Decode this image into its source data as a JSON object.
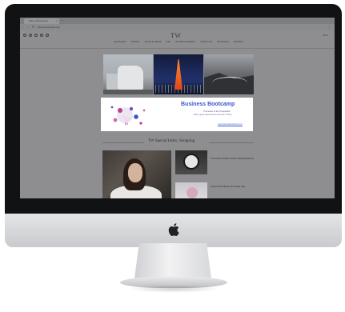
{
  "browser": {
    "tab_title": "Tokyo Weekender",
    "tab_close": "×",
    "new_tab": "+",
    "url": "tokyoweekender.com",
    "menu": "⋮",
    "nav_back": "‹",
    "nav_forward": "›",
    "nav_reload": "↻"
  },
  "site": {
    "logo": "TW",
    "header_right": "EN ▾",
    "nav": [
      "FEATURES",
      "TRAVEL",
      "FOOD & DRINK",
      "ART",
      "ENTERTAINMENT",
      "LIFESTYLE",
      "BUSINESS",
      "PEOPLE"
    ]
  },
  "photos": {
    "labels": [
      "",
      "",
      ""
    ]
  },
  "banner": {
    "title": "Business Bootcamp",
    "sub1": "The Home of the Competitive",
    "sub2": "Where great ideas become success in Tokyo",
    "link": "www.businessbootcamp.com"
  },
  "section": {
    "title": "TW Special Index: Shopping"
  },
  "articles": [
    {
      "category": "",
      "text": "The Hamlet Of Brand And Its Global Expansion"
    },
    {
      "category": "",
      "text": "Tokyo Flower Market: Be A Daily Stop"
    }
  ],
  "colors": {
    "banner_accent": "#3a55c9",
    "screen_dim": "#8e8e90",
    "bezel": "#111214"
  }
}
